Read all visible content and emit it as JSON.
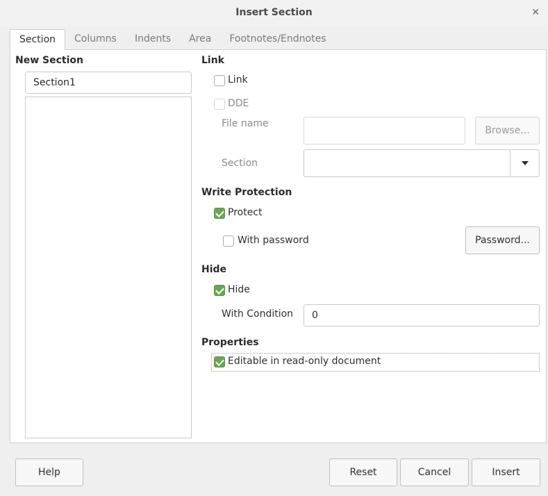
{
  "window": {
    "title": "Insert Section"
  },
  "tabs": [
    {
      "label": "Section",
      "active": true
    },
    {
      "label": "Columns"
    },
    {
      "label": "Indents"
    },
    {
      "label": "Area"
    },
    {
      "label": "Footnotes/Endnotes"
    }
  ],
  "new_section": {
    "heading": "New Section",
    "name_value": "Section1"
  },
  "link": {
    "heading": "Link",
    "link_label": "Link",
    "link_checked": false,
    "dde_label": "DDE",
    "dde_checked": false,
    "file_name_label": "File name",
    "file_name_value": "",
    "browse_label": "Browse...",
    "section_label": "Section",
    "section_value": ""
  },
  "write_protection": {
    "heading": "Write Protection",
    "protect_label": "Protect",
    "protect_checked": true,
    "with_password_label": "With password",
    "with_password_checked": false,
    "password_button": "Password..."
  },
  "hide": {
    "heading": "Hide",
    "hide_label": "Hide",
    "hide_checked": true,
    "with_condition_label": "With Condition",
    "with_condition_value": "0"
  },
  "properties": {
    "heading": "Properties",
    "editable_label": "Editable in read-only document",
    "editable_checked": true
  },
  "footer": {
    "help": "Help",
    "reset": "Reset",
    "cancel": "Cancel",
    "insert": "Insert"
  },
  "colors": {
    "check_accent": "#6aa84f"
  }
}
